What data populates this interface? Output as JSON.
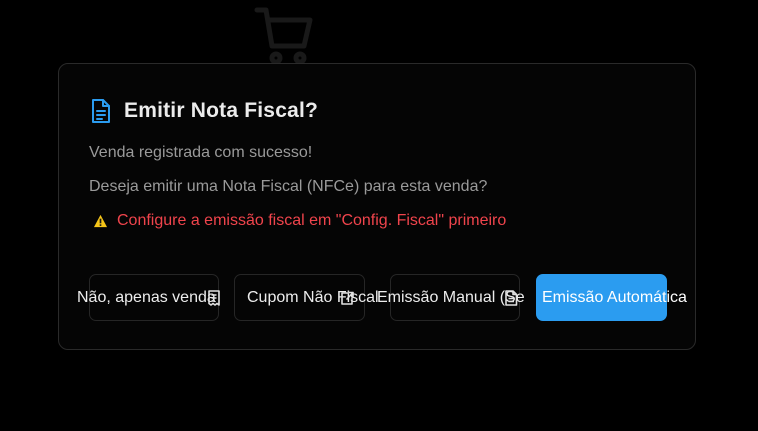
{
  "background": {
    "icon": "shopping-cart-icon"
  },
  "dialog": {
    "title_icon": "document-icon",
    "title": "Emitir Nota Fiscal?",
    "message_success": "Venda registrada com sucesso!",
    "message_question": "Deseja emitir uma Nota Fiscal (NFCe) para esta venda?",
    "warning_icon": "warning-triangle-icon",
    "warning_text": "Configure a emissão fiscal em \"Config. Fiscal\" primeiro",
    "buttons": [
      {
        "label": "Não, apenas venda",
        "icon": "receipt-icon"
      },
      {
        "label": "Cupom Não Fiscal",
        "icon": "external-link-icon"
      },
      {
        "label": "Emissão Manual (Se",
        "icon": "file-icon"
      },
      {
        "label": "Emissão Automática"
      }
    ]
  },
  "colors": {
    "accent": "#2b9cf0",
    "warning": "#f0444c",
    "warning_icon": "#f5c518",
    "background": "#000000"
  }
}
